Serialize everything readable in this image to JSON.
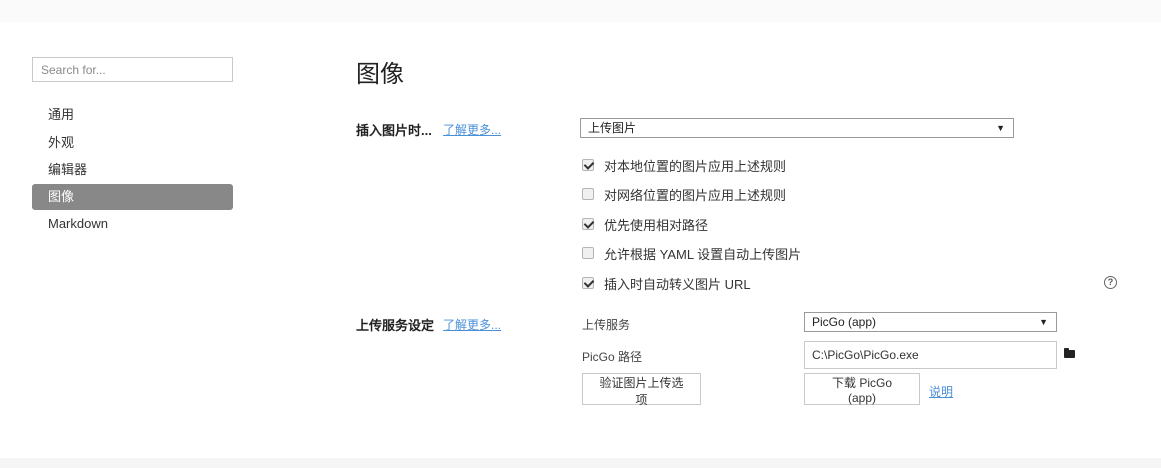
{
  "sidebar": {
    "search_placeholder": "Search for...",
    "items": [
      {
        "label": "通用"
      },
      {
        "label": "外观"
      },
      {
        "label": "编辑器"
      },
      {
        "label": "图像",
        "active": true
      },
      {
        "label": "Markdown"
      }
    ]
  },
  "main": {
    "title": "图像",
    "insert": {
      "label": "插入图片时...",
      "learn_more": "了解更多...",
      "action_select": "上传图片",
      "options": [
        {
          "label": "对本地位置的图片应用上述规则",
          "checked": true
        },
        {
          "label": "对网络位置的图片应用上述规则",
          "checked": false
        },
        {
          "label": "优先使用相对路径",
          "checked": true
        },
        {
          "label": "允许根据 YAML 设置自动上传图片",
          "checked": false
        },
        {
          "label": "插入时自动转义图片 URL",
          "checked": true
        }
      ],
      "help_glyph": "?"
    },
    "upload": {
      "label": "上传服务设定",
      "learn_more": "了解更多...",
      "service_label": "上传服务",
      "service_value": "PicGo (app)",
      "path_label": "PicGo 路径",
      "path_value": "C:\\PicGo\\PicGo.exe",
      "verify_button": "验证图片上传选项",
      "download_button": "下载 PicGo (app)",
      "help_link": "说明"
    }
  },
  "icons": {
    "caret": "▼",
    "folder": "folder-icon",
    "help": "help-circle-icon"
  }
}
